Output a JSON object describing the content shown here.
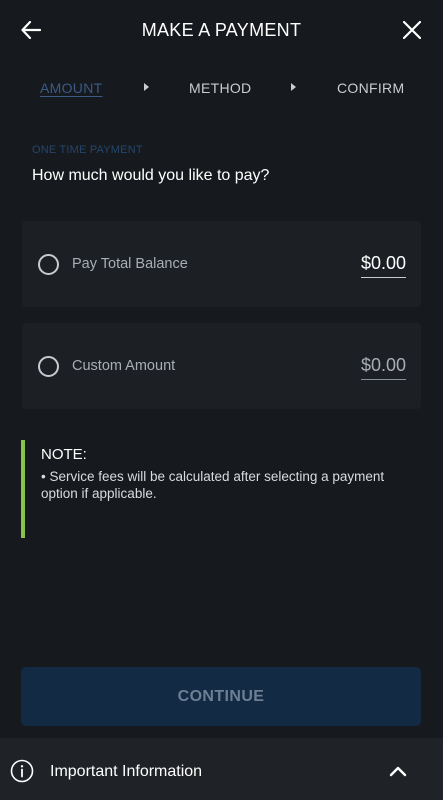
{
  "header": {
    "title": "MAKE A PAYMENT",
    "back_icon": "arrow-left-icon",
    "close_icon": "close-icon"
  },
  "steps": [
    {
      "label": "AMOUNT",
      "active": true
    },
    {
      "label": "METHOD",
      "active": false
    },
    {
      "label": "CONFIRM",
      "active": false
    }
  ],
  "form": {
    "subheading": "ONE TIME PAYMENT",
    "question": "How much would you like to pay?",
    "options": [
      {
        "label": "Pay Total Balance",
        "amount": "$0.00",
        "selected": false
      },
      {
        "label": "Custom Amount",
        "amount": "$0.00",
        "selected": false
      }
    ]
  },
  "note": {
    "title": "NOTE:",
    "body": "• Service fees will be calculated after selecting a payment option if applicable."
  },
  "continue_label": "CONTINUE",
  "footer": {
    "label": "Important Information",
    "icon": "info-icon",
    "toggle_icon": "chevron-up-icon"
  },
  "colors": {
    "background": "#16191d",
    "active_step": "#3c5a87",
    "note_accent": "#8bc34a",
    "continue_bg": "#122a44"
  }
}
